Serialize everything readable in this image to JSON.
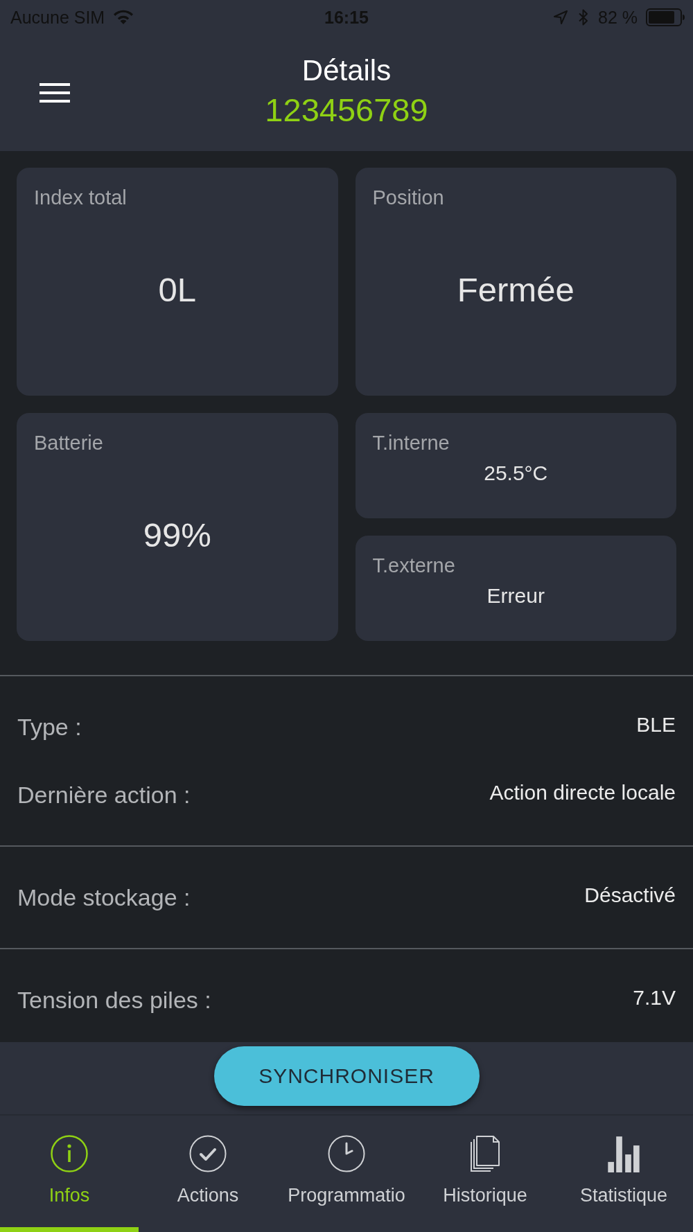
{
  "status_bar": {
    "carrier": "Aucune SIM",
    "time": "16:15",
    "battery": "82 %"
  },
  "header": {
    "title": "Détails",
    "subtitle": "123456789"
  },
  "tiles": [
    {
      "kind": "large",
      "label": "Index total",
      "value": "0L"
    },
    {
      "kind": "large",
      "label": "Position",
      "value": "Fermée"
    },
    {
      "kind": "large",
      "label": "Batterie",
      "value": "99%"
    },
    {
      "kind": "small",
      "label": "T.interne",
      "value": "25.5°C"
    },
    {
      "kind": "small",
      "label": "T.externe",
      "value": "Erreur"
    }
  ],
  "info_sections": [
    {
      "rows": [
        {
          "label": "Type :",
          "value": "BLE"
        },
        {
          "label": "Dernière action :",
          "value": "Action directe locale"
        }
      ]
    },
    {
      "rows": [
        {
          "label": "Mode stockage :",
          "value": "Désactivé"
        }
      ]
    },
    {
      "rows": [
        {
          "label": "Tension des piles :",
          "value": "7.1V"
        }
      ]
    }
  ],
  "sync_button": {
    "label": "SYNCHRONISER"
  },
  "tabs": [
    {
      "label": "Infos",
      "selected": true
    },
    {
      "label": "Actions",
      "selected": false
    },
    {
      "label": "Programmatio",
      "selected": false
    },
    {
      "label": "Historique",
      "selected": false
    },
    {
      "label": "Statistique",
      "selected": false
    }
  ]
}
